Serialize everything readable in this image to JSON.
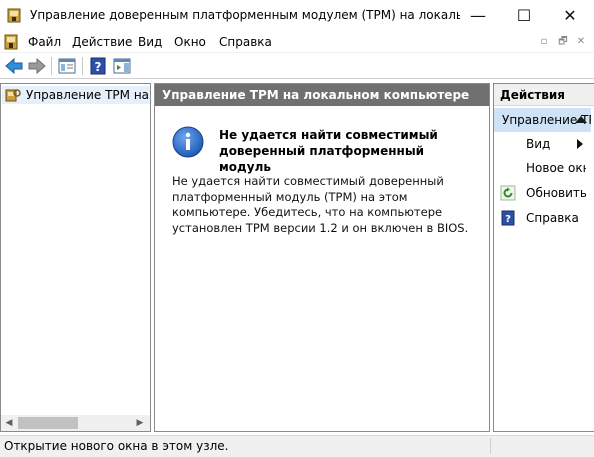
{
  "window": {
    "title": "Управление доверенным платформенным модулем (TPM) на локальном к...",
    "icon": "tpm-key-icon",
    "controls": {
      "minimize": "—",
      "maximize": "☐",
      "close": "✕"
    }
  },
  "menu": {
    "items": [
      "Файл",
      "Действие",
      "Вид",
      "Окно",
      "Справка"
    ],
    "mdi_controls": [
      "▫",
      "🗗",
      "✕"
    ]
  },
  "toolbar": {
    "buttons": [
      "back-arrow-icon",
      "forward-arrow-icon",
      "show-hide-tree-icon",
      "help-icon",
      "show-action-pane-icon"
    ]
  },
  "tree": {
    "items": [
      {
        "label": "Управление TPM на локальном компьютере",
        "icon": "tpm-key-icon"
      }
    ]
  },
  "main": {
    "header": "Управление TPM на локальном компьютере",
    "message": {
      "title": "Не удается найти совместимый доверенный платформенный модуль",
      "body": "Не удается найти совместимый доверенный платформенный модуль (TPM) на этом компьютере. Убедитесь, что на компьютере установлен TPM версии 1.2 и он включен в BIOS.",
      "icon": "info-icon"
    }
  },
  "actions": {
    "header": "Действия",
    "section": "Управление TPM на локальном компьютере",
    "items": [
      {
        "label": "Вид",
        "icon": ""
      },
      {
        "label": "Новое окно отсюда",
        "icon": ""
      },
      {
        "label": "Обновить",
        "icon": "refresh-icon"
      },
      {
        "label": "Справка",
        "icon": "help-icon"
      }
    ]
  },
  "status": {
    "text": "Открытие нового окна в этом узле."
  },
  "colors": {
    "header_bg": "#707070",
    "section_bg": "#cfe3f7",
    "tree_selected": "#e5f0fb",
    "info_blue": "#1f5bb8"
  }
}
